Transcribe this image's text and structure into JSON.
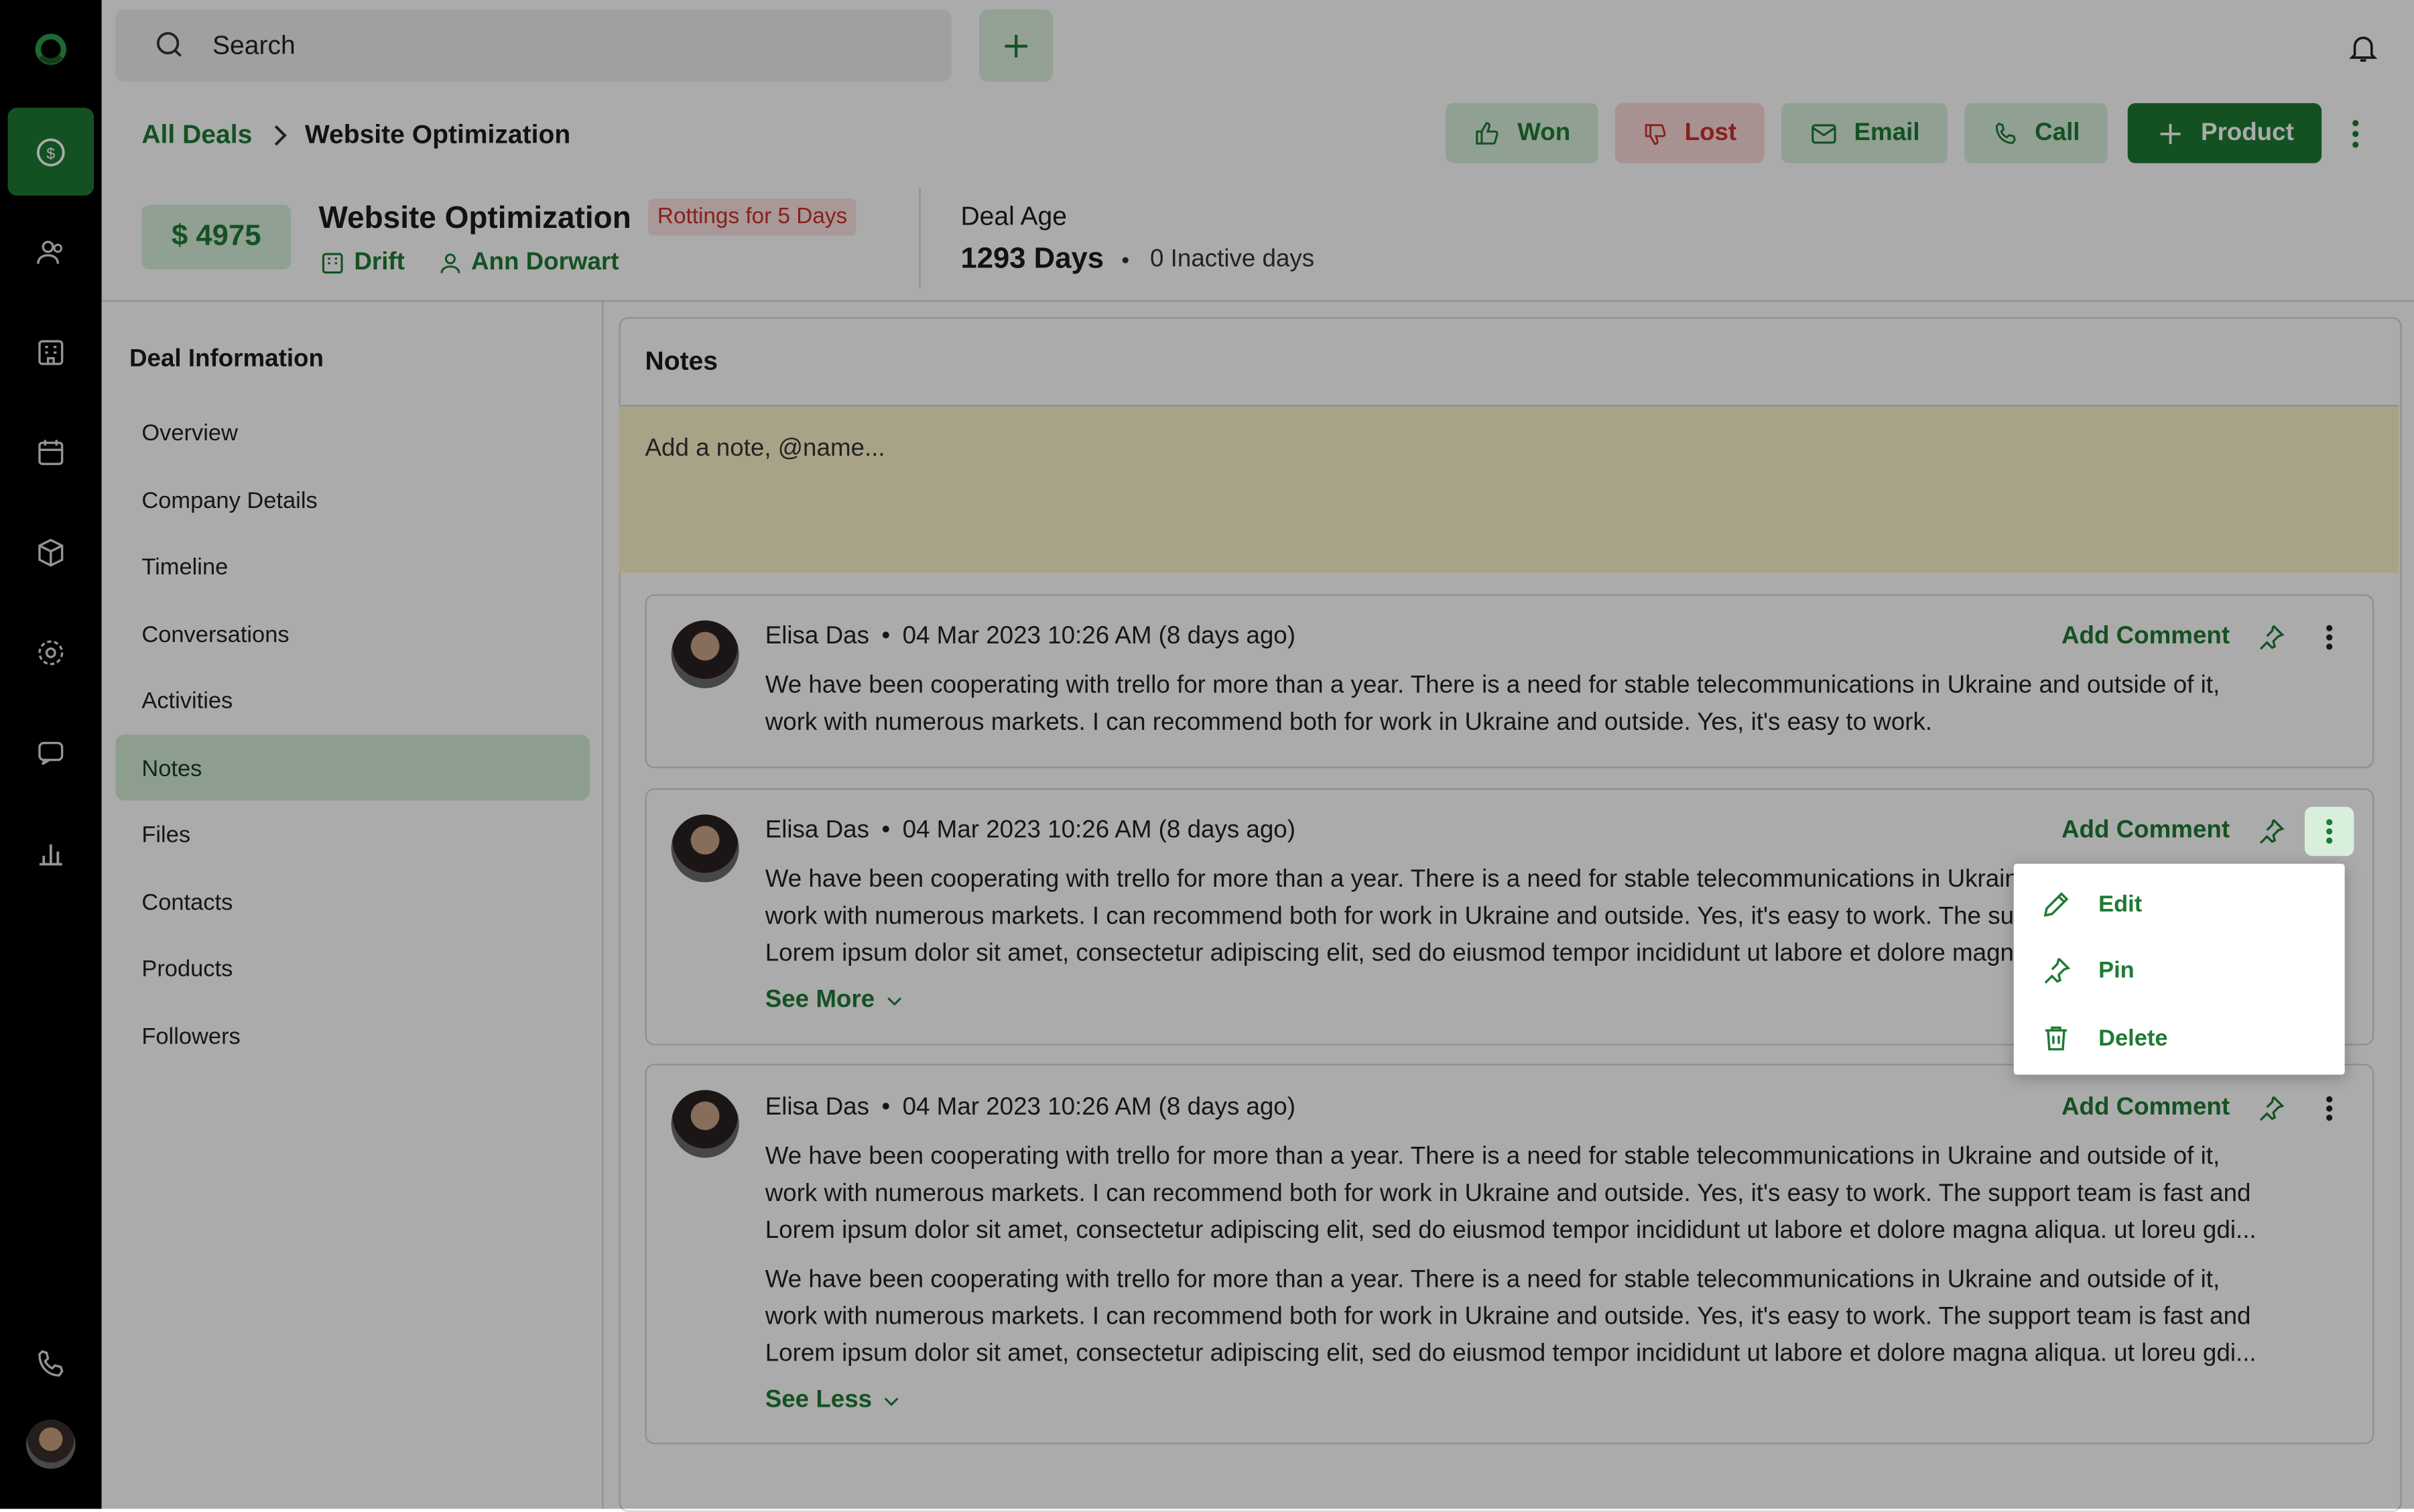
{
  "colors": {
    "brand_green": "#1f7a33",
    "light_green": "#d7efdb",
    "danger_red": "#c9302c",
    "note_yellow": "#fbf3c9",
    "sidebar_black": "#000000"
  },
  "sidebar": {
    "icons": [
      "logo-icon",
      "deals-icon",
      "people-icon",
      "building-icon",
      "calendar-icon",
      "box-icon",
      "gear-icon",
      "chat-icon",
      "chart-icon",
      "phone-icon",
      "avatar"
    ]
  },
  "topbar": {
    "search_label": "Search"
  },
  "breadcrumb": {
    "root": "All Deals",
    "current": "Website Optimization"
  },
  "actions": {
    "won": "Won",
    "lost": "Lost",
    "email": "Email",
    "call": "Call",
    "product": "Product"
  },
  "deal": {
    "price": "$ 4975",
    "title": "Website Optimization",
    "rot_badge": "Rottings for 5 Days",
    "company": "Drift",
    "owner": "Ann Dorwart",
    "age_label": "Deal Age",
    "age_value": "1293 Days",
    "inactive": "0 Inactive days"
  },
  "leftnav": {
    "heading": "Deal Information",
    "items": [
      {
        "label": "Overview"
      },
      {
        "label": "Company Details"
      },
      {
        "label": "Timeline"
      },
      {
        "label": "Conversations"
      },
      {
        "label": "Activities"
      },
      {
        "label": "Notes",
        "active": true
      },
      {
        "label": "Files"
      },
      {
        "label": "Contacts"
      },
      {
        "label": "Products"
      },
      {
        "label": "Followers"
      }
    ]
  },
  "notes": {
    "heading": "Notes",
    "placeholder": "Add a note, @name...",
    "add_comment": "Add Comment",
    "items": [
      {
        "author": "Elisa Das",
        "time": "04 Mar 2023 10:26 AM (8 days ago)",
        "lines": [
          "We have been cooperating with trello for more than a year. There is a need for stable telecommunications in Ukraine and outside of it,",
          "work with numerous markets. I can recommend both for work in Ukraine and outside. Yes, it's easy to work."
        ]
      },
      {
        "author": "Elisa Das",
        "time": "04 Mar 2023 10:26 AM (8 days ago)",
        "lines": [
          "We have been cooperating with trello for more than a year. There is a need for stable telecommunications in Ukraine and outside of it,",
          "work with numerous markets. I can recommend both for work in Ukraine and outside. Yes, it's easy to work. The support team is fast and",
          "Lorem ipsum dolor sit amet, consectetur adipiscing elit, sed do eiusmod tempor incididunt ut labore et dolore magna aliqua. ut loreu gdi..."
        ],
        "toggle": "See More"
      },
      {
        "author": "Elisa Das",
        "time": "04 Mar 2023 10:26 AM (8 days ago)",
        "lines": [
          "We have been cooperating with trello for more than a year. There is a need for stable telecommunications in Ukraine and outside of it,",
          "work with numerous markets. I can recommend both for work in Ukraine and outside. Yes, it's easy to work. The support team is fast and",
          "Lorem ipsum dolor sit amet, consectetur adipiscing elit, sed do eiusmod tempor incididunt ut labore et dolore magna aliqua. ut loreu gdi..."
        ],
        "lines2": [
          "We have been cooperating with trello for more than a year. There is a need for stable telecommunications in Ukraine and outside of it,",
          "work with numerous markets. I can recommend both for work in Ukraine and outside. Yes, it's easy to work. The support team is fast and",
          "Lorem ipsum dolor sit amet, consectetur adipiscing elit, sed do eiusmod tempor incididunt ut labore et dolore magna aliqua. ut loreu gdi..."
        ],
        "toggle": "See Less"
      }
    ]
  },
  "menu": {
    "items": [
      {
        "label": "Edit",
        "icon": "pencil-icon"
      },
      {
        "label": "Pin",
        "icon": "pin-icon"
      },
      {
        "label": "Delete",
        "icon": "trash-icon"
      }
    ]
  }
}
